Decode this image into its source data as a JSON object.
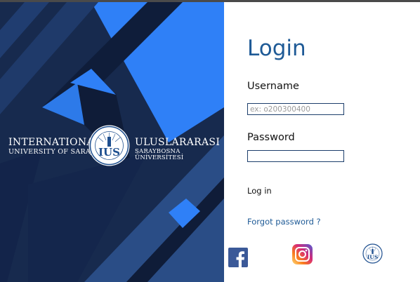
{
  "branding": {
    "left_line1": "INTERNATIONAL",
    "left_line2": "UNIVERSITY OF SARAJEVO",
    "right_line1": "ULUSLARARASI",
    "right_line2": "SARAYBOSNA ÜNİVERSİTESİ",
    "seal_text": "IUS",
    "seal_ring_text": "INTERNATIONAL UNIVERSITY OF SARAJEVO"
  },
  "login": {
    "title": "Login",
    "username_label": "Username",
    "username_placeholder": "ex: o200300400",
    "username_value": "",
    "password_label": "Password",
    "password_value": "",
    "login_button": "Log in",
    "forgot_link": "Forgot password ?"
  },
  "social": {
    "facebook_icon": "facebook-icon",
    "instagram_icon": "instagram-icon",
    "ius_logo_icon": "ius-logo-icon"
  },
  "colors": {
    "panel_dark": "#172a4e",
    "panel_accent": "#2f80f7",
    "title_blue": "#1e5a96"
  }
}
